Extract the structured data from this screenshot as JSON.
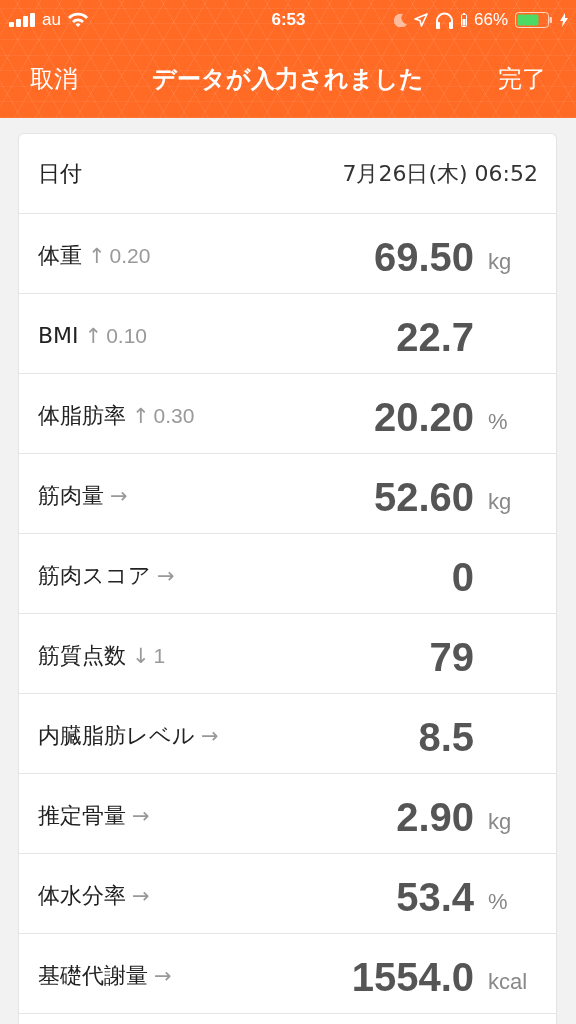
{
  "status_bar": {
    "carrier": "au",
    "time": "6:53",
    "battery_percent": "66%"
  },
  "nav_bar": {
    "cancel": "取消",
    "title": "データが入力されました",
    "done": "完了"
  },
  "date_row": {
    "label": "日付",
    "value": "7月26日(木) 06:52"
  },
  "measurements": [
    {
      "label": "体重",
      "trend": "↑",
      "change": "0.20",
      "value": "69.50",
      "unit": "kg"
    },
    {
      "label": "BMI",
      "trend": "↑",
      "change": "0.10",
      "value": "22.7"
    },
    {
      "label": "体脂肪率",
      "trend": "↑",
      "change": "0.30",
      "value": "20.20",
      "unit": "%"
    },
    {
      "label": "筋肉量",
      "trend": "→",
      "value": "52.60",
      "unit": "kg"
    },
    {
      "label": "筋肉スコア",
      "trend": "→",
      "value": "0"
    },
    {
      "label": "筋質点数",
      "trend": "↓",
      "change": "1",
      "value": "79"
    },
    {
      "label": "内臓脂肪レベル",
      "trend": "→",
      "value": "8.5"
    },
    {
      "label": "推定骨量",
      "trend": "→",
      "value": "2.90",
      "unit": "kg"
    },
    {
      "label": "体水分率",
      "trend": "→",
      "value": "53.4",
      "unit": "%"
    },
    {
      "label": "基礎代謝量",
      "trend": "→",
      "value": "1554.0",
      "unit": "kcal"
    }
  ]
}
